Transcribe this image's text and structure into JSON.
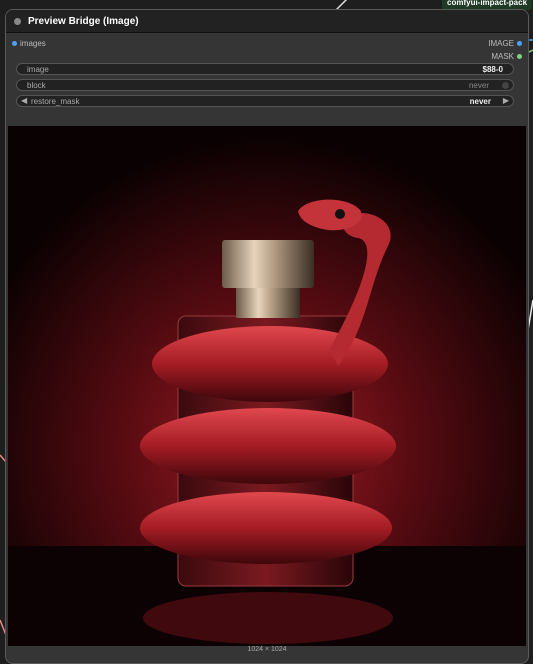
{
  "badge": {
    "text": "comfyui-impact-pack"
  },
  "node": {
    "title": "Preview Bridge (Image)",
    "inputs": [
      {
        "label": "images",
        "color": "#4aa3ff"
      }
    ],
    "outputs": [
      {
        "label": "IMAGE",
        "color": "#4aa3ff"
      },
      {
        "label": "MASK",
        "color": "#7cd67c"
      }
    ],
    "widgets": {
      "image": {
        "label": "image",
        "value": "$88-0"
      },
      "block": {
        "label": "block",
        "value": "never"
      },
      "restore_mask": {
        "label": "restore_mask",
        "value": "never"
      }
    }
  },
  "preview": {
    "description_icon": "perfume-bottle-with-snake-image",
    "size_label": "1024 × 1024"
  },
  "colors": {
    "node_bg": "#353535",
    "title_bg": "#222222",
    "widget_bg": "#222222",
    "accent_red": "#b0202a"
  }
}
